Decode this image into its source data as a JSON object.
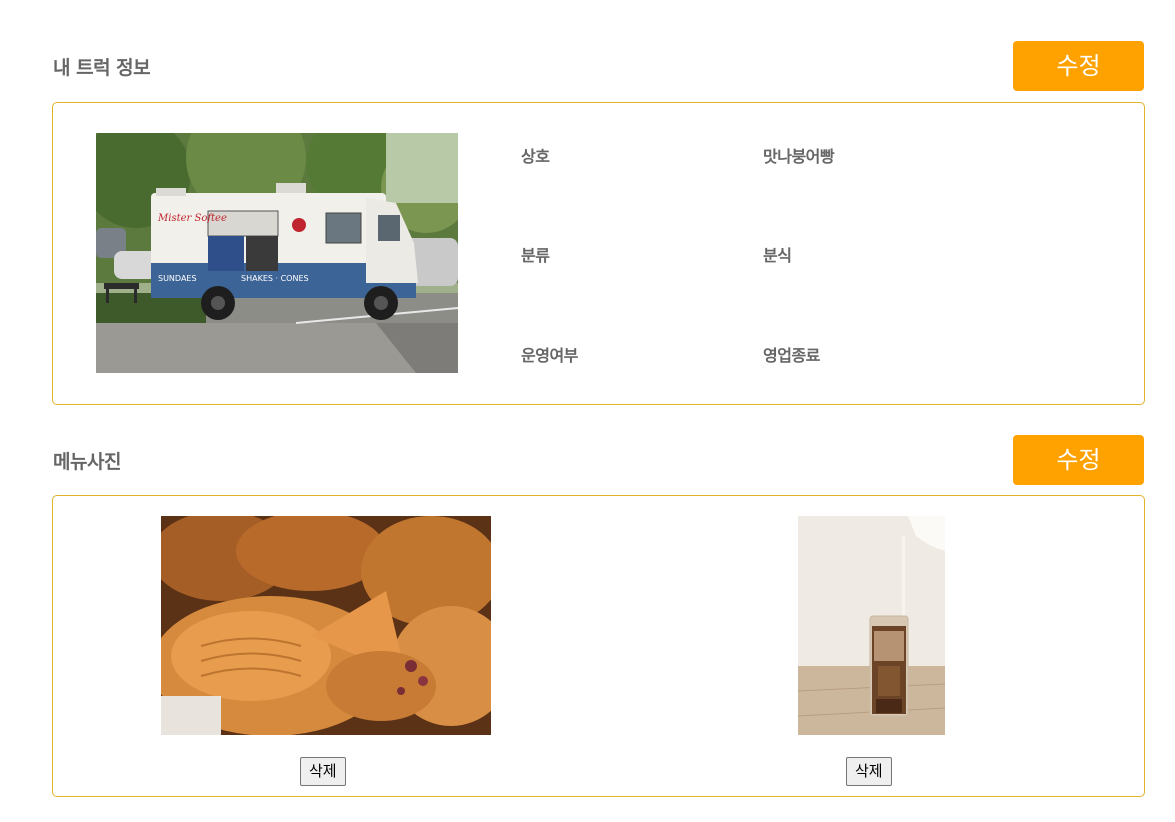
{
  "truck_info": {
    "title": "내 트럭 정보",
    "edit_label": "수정",
    "fields": [
      {
        "label": "상호",
        "value": "맛나붕어빵"
      },
      {
        "label": "분류",
        "value": "분식"
      },
      {
        "label": "운영여부",
        "value": "영업종료"
      }
    ]
  },
  "menu_photos": {
    "title": "메뉴사진",
    "edit_label": "수정",
    "items": [
      {
        "delete_label": "삭제"
      },
      {
        "delete_label": "삭제"
      }
    ]
  },
  "colors": {
    "accent": "#ffa200",
    "border": "#e0b32b",
    "label_text": "#666666"
  }
}
